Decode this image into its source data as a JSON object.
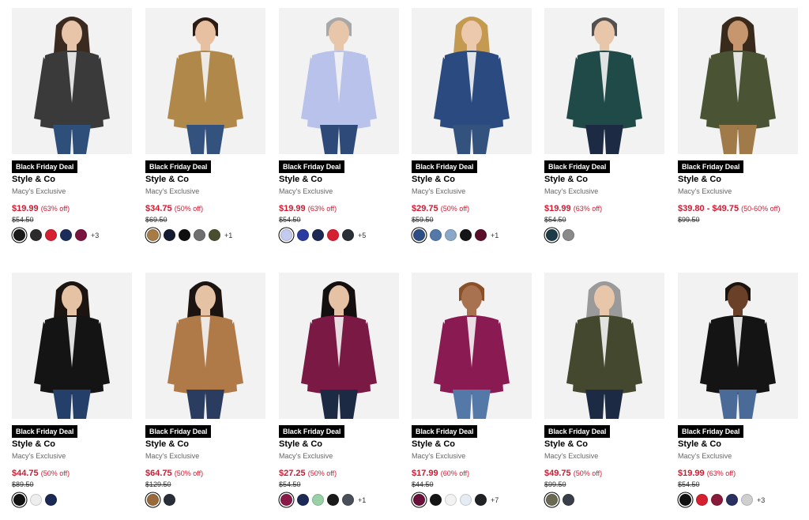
{
  "products": [
    {
      "deal": "Black Friday Deal",
      "brand": "Style & Co",
      "exclusive": "Macy's Exclusive",
      "sale": "$19.99",
      "off": "(63% off)",
      "orig": "$54.50",
      "more": "+3",
      "jacket": "#3a3a3a",
      "pants": "#2d4f7a",
      "skin": "#e8c4a8",
      "hair": "#3a2a20",
      "swatches": [
        "#1a1a1a",
        "#2b2b2b",
        "#d42030",
        "#1d2d5a",
        "#7a1440"
      ]
    },
    {
      "deal": "Black Friday Deal",
      "brand": "Style & Co",
      "exclusive": "Macy's Exclusive",
      "sale": "$34.75",
      "off": "(50% off)",
      "orig": "$69.50",
      "more": "+1",
      "jacket": "#b0884a",
      "pants": "#34527e",
      "skin": "#e6c0a0",
      "hair": "#2a1c14",
      "swatches": [
        "#a67b45",
        "#141c30",
        "#101010",
        "#6f6f6f",
        "#4a4e30"
      ]
    },
    {
      "deal": "Black Friday Deal",
      "brand": "Style & Co",
      "exclusive": "Macy's Exclusive",
      "sale": "$19.99",
      "off": "(63% off)",
      "orig": "$54.50",
      "more": "+5",
      "jacket": "#b8c2ea",
      "pants": "#2e4a78",
      "skin": "#e8c6aa",
      "hair": "#a8a8a8",
      "swatches": [
        "#c3cbf0",
        "#2a3aa0",
        "#1b2a55",
        "#d42030",
        "#2a2e36"
      ]
    },
    {
      "deal": "Black Friday Deal",
      "brand": "Style & Co",
      "exclusive": "Macy's Exclusive",
      "sale": "$29.75",
      "off": "(50% off)",
      "orig": "$59.50",
      "more": "+1",
      "jacket": "#2a4a80",
      "pants": "#34527e",
      "skin": "#ecc8ac",
      "hair": "#c49a50",
      "swatches": [
        "#2d4d86",
        "#5478a8",
        "#8aa8c8",
        "#151515",
        "#5a0e2a"
      ]
    },
    {
      "deal": "Black Friday Deal",
      "brand": "Style & Co",
      "exclusive": "Macy's Exclusive",
      "sale": "$19.99",
      "off": "(63% off)",
      "orig": "$54.50",
      "more": "",
      "jacket": "#1f4a48",
      "pants": "#1d2a44",
      "skin": "#e8c6aa",
      "hair": "#555050",
      "swatches": [
        "#1d3a48",
        "#8a8a8a"
      ]
    },
    {
      "deal": "Black Friday Deal",
      "brand": "Style & Co",
      "exclusive": "Macy's Exclusive",
      "sale": "$39.80 - $49.75",
      "off": "(50-60% off)",
      "orig": "$99.50",
      "more": "",
      "jacket": "#4a5434",
      "pants": "#a07a48",
      "skin": "#c8966e",
      "hair": "#3a2a1c",
      "swatches": []
    },
    {
      "deal": "Black Friday Deal",
      "brand": "Style & Co",
      "exclusive": "Macy's Exclusive",
      "sale": "$44.75",
      "off": "(50% off)",
      "orig": "$89.50",
      "more": "",
      "jacket": "#141414",
      "pants": "#24406a",
      "skin": "#e6c2a4",
      "hair": "#1c1410",
      "swatches": [
        "#111111",
        "#eeeeee",
        "#1b2a55"
      ]
    },
    {
      "deal": "Black Friday Deal",
      "brand": "Style & Co",
      "exclusive": "Macy's Exclusive",
      "sale": "$64.75",
      "off": "(50% off)",
      "orig": "$129.50",
      "more": "",
      "jacket": "#b07a48",
      "pants": "#2a3c60",
      "skin": "#e6c2a4",
      "hair": "#1c1410",
      "swatches": [
        "#9a6a3a",
        "#2a2e38"
      ]
    },
    {
      "deal": "Black Friday Deal",
      "brand": "Style & Co",
      "exclusive": "Macy's Exclusive",
      "sale": "$27.25",
      "off": "(50% off)",
      "orig": "$54.50",
      "more": "+1",
      "jacket": "#7a1a44",
      "pants": "#1d2a44",
      "skin": "#e6c2a4",
      "hair": "#141010",
      "swatches": [
        "#8a1a4a",
        "#1d2a55",
        "#9ad0a8",
        "#1a1a1a",
        "#4a4e58"
      ]
    },
    {
      "deal": "Black Friday Deal",
      "brand": "Style & Co",
      "exclusive": "Macy's Exclusive",
      "sale": "$17.99",
      "off": "(60% off)",
      "orig": "$44.50",
      "more": "+7",
      "jacket": "#8a1a52",
      "pants": "#5478a8",
      "skin": "#a87250",
      "hair": "#8a5028",
      "swatches": [
        "#6a0e3a",
        "#151515",
        "#f2f2f2",
        "#e6ecf4",
        "#202226"
      ]
    },
    {
      "deal": "Black Friday Deal",
      "brand": "Style & Co",
      "exclusive": "Macy's Exclusive",
      "sale": "$49.75",
      "off": "(50% off)",
      "orig": "$99.50",
      "more": "",
      "jacket": "#44482e",
      "pants": "#1d2a44",
      "skin": "#e8c6aa",
      "hair": "#9a9a9a",
      "swatches": [
        "#6a6a54",
        "#3a3e48"
      ]
    },
    {
      "deal": "Black Friday Deal",
      "brand": "Style & Co",
      "exclusive": "Macy's Exclusive",
      "sale": "$19.99",
      "off": "(63% off)",
      "orig": "$54.50",
      "more": "+3",
      "jacket": "#141414",
      "pants": "#4a6a98",
      "skin": "#6a4028",
      "hair": "#1c1410",
      "swatches": [
        "#111111",
        "#d42030",
        "#8a1a3a",
        "#2a3060",
        "#cfcfcf"
      ]
    }
  ]
}
